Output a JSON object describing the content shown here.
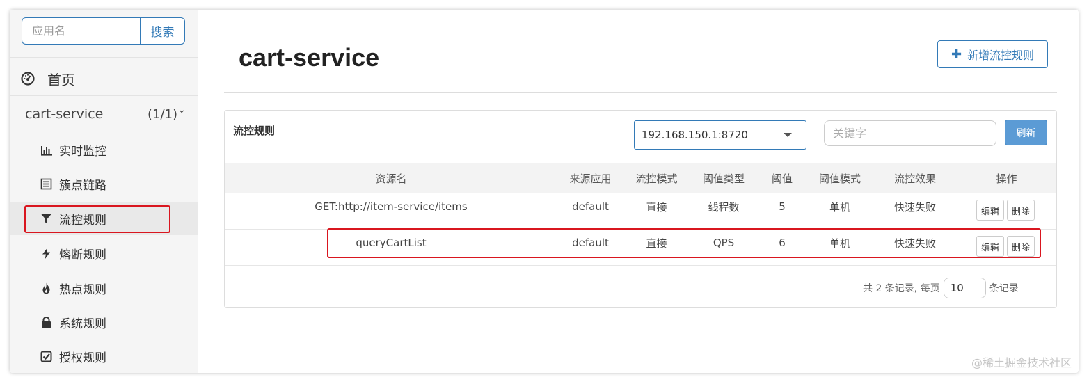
{
  "sidebar": {
    "search_placeholder": "应用名",
    "search_button": "搜索",
    "home_label": "首页",
    "app": {
      "name": "cart-service",
      "count": "(1/1)"
    },
    "items": [
      {
        "label": "实时监控",
        "icon": "bar-chart-icon"
      },
      {
        "label": "簇点链路",
        "icon": "list-icon"
      },
      {
        "label": "流控规则",
        "icon": "filter-icon"
      },
      {
        "label": "熔断规则",
        "icon": "bolt-icon"
      },
      {
        "label": "热点规则",
        "icon": "fire-icon"
      },
      {
        "label": "系统规则",
        "icon": "lock-icon"
      },
      {
        "label": "授权规则",
        "icon": "check-square-icon"
      }
    ],
    "active_item": "流控规则"
  },
  "main": {
    "title": "cart-service",
    "add_button": "新增流控规则"
  },
  "panel": {
    "title": "流控规则",
    "machine": "192.168.150.1:8720",
    "keyword_placeholder": "关键字",
    "refresh_label": "刷新"
  },
  "table": {
    "columns": [
      "资源名",
      "来源应用",
      "流控模式",
      "阈值类型",
      "阈值",
      "阈值模式",
      "流控效果",
      "操作"
    ],
    "rows": [
      [
        "GET:http://item-service/items",
        "default",
        "直接",
        "线程数",
        "5",
        "单机",
        "快速失败"
      ],
      [
        "queryCartList",
        "default",
        "直接",
        "QPS",
        "6",
        "单机",
        "快速失败"
      ]
    ],
    "edit_label": "编辑",
    "delete_label": "删除"
  },
  "pagination": {
    "total_text": "共 2 条记录, 每页",
    "page_size": "10",
    "suffix": "条记录"
  },
  "watermark": "@稀土掘金技术社区",
  "colors": {
    "accent": "#337ab7",
    "highlight": "#d9161f",
    "refresh": "#5b9bd5"
  }
}
